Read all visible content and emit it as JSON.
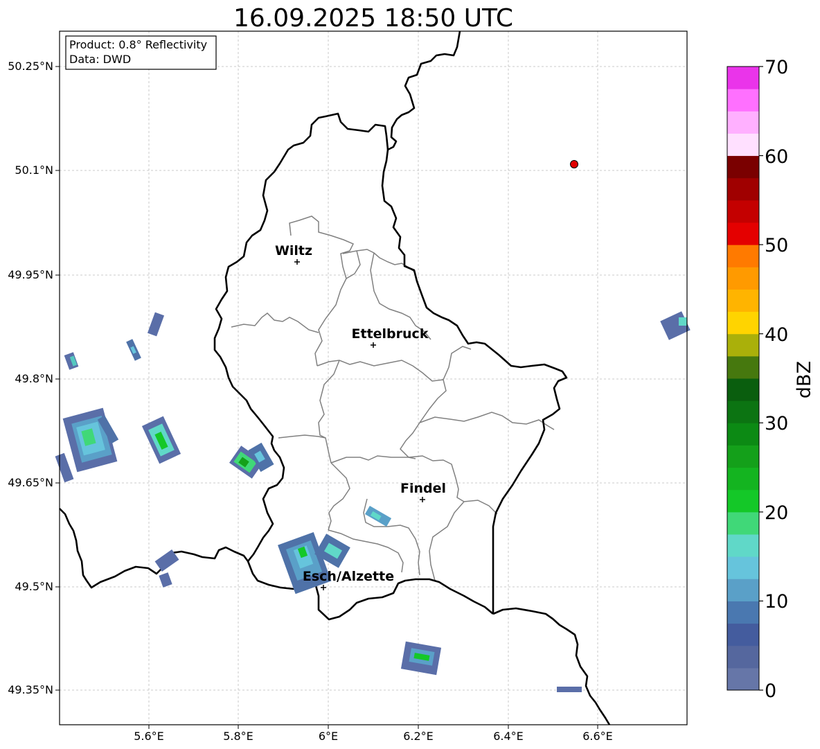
{
  "title": "16.09.2025 18:50 UTC",
  "info_box": {
    "product": "Product: 0.8° Reflectivity",
    "source": "Data: DWD"
  },
  "axes": {
    "lon_ticks": [
      "5.6°E",
      "5.8°E",
      "6°E",
      "6.2°E",
      "6.4°E",
      "6.6°E"
    ],
    "lat_ticks": [
      "50.25°N",
      "50.1°N",
      "49.95°N",
      "49.8°N",
      "49.65°N",
      "49.5°N",
      "49.35°N"
    ],
    "grid": true
  },
  "cities": [
    {
      "name": "Wiltz"
    },
    {
      "name": "Ettelbruck"
    },
    {
      "name": "Findel"
    },
    {
      "name": "Esch/Alzette"
    }
  ],
  "marker": {
    "color": "#e00000"
  },
  "colorbar": {
    "label": "dBZ",
    "ticks": [
      "0",
      "10",
      "20",
      "30",
      "40",
      "50",
      "60",
      "70"
    ],
    "colors": [
      "#6676a8",
      "#55679e",
      "#445c9e",
      "#4a78b0",
      "#5aa0c8",
      "#66c4dc",
      "#60d8c8",
      "#40d878",
      "#14c828",
      "#14b420",
      "#14a01a",
      "#0c8a14",
      "#0c7412",
      "#0a5e0e",
      "#46780e",
      "#aab00a",
      "#ffd400",
      "#ffb400",
      "#ff9a00",
      "#ff7a00",
      "#e40000",
      "#c40000",
      "#a00000",
      "#7a0000",
      "#ffe0ff",
      "#ffb0ff",
      "#ff70ff",
      "#ea34ea"
    ]
  },
  "colors": {
    "border": "#000000",
    "canton": "#808080",
    "grid": "#bbbbbb"
  }
}
